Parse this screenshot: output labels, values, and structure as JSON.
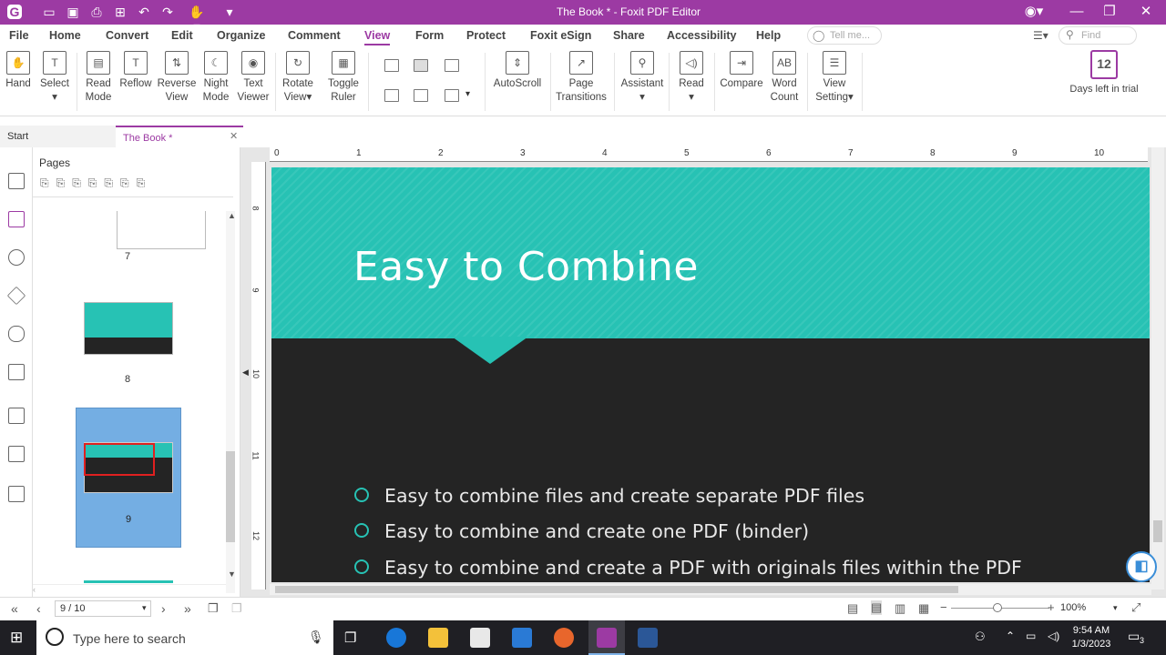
{
  "app": {
    "title": "The Book * - Foxit PDF Editor",
    "accent": "#9c3aa3"
  },
  "menu": [
    "File",
    "Home",
    "Convert",
    "Edit",
    "Organize",
    "Comment",
    "View",
    "Form",
    "Protect",
    "Foxit eSign",
    "Share",
    "Accessibility",
    "Help"
  ],
  "menu_active": "View",
  "search": {
    "tellme": "Tell me...",
    "find": "Find"
  },
  "ribbon": {
    "hand": "Hand",
    "select": "Select",
    "read_mode": [
      "Read",
      "Mode"
    ],
    "reflow": "Reflow",
    "reverse_view": [
      "Reverse",
      "View"
    ],
    "night_mode": [
      "Night",
      "Mode"
    ],
    "text_viewer": [
      "Text",
      "Viewer"
    ],
    "rotate_view": [
      "Rotate",
      "View▾"
    ],
    "toggle_ruler": [
      "Toggle",
      "Ruler"
    ],
    "autoscroll": "AutoScroll",
    "page_transitions": [
      "Page",
      "Transitions"
    ],
    "assistant": "Assistant",
    "read": "Read",
    "compare": "Compare",
    "word_count": [
      "Word",
      "Count"
    ],
    "view_setting": [
      "View",
      "Setting▾"
    ],
    "trial_days": "12",
    "trial_label": "Days left in trial"
  },
  "tabs": {
    "start": "Start",
    "doc": "The Book *"
  },
  "panel": {
    "title": "Pages",
    "pages": [
      "7",
      "8",
      "9"
    ]
  },
  "ruler": {
    "h": [
      "0",
      "1",
      "2",
      "3",
      "4",
      "5",
      "6",
      "7",
      "8",
      "9",
      "10"
    ],
    "v": [
      "8",
      "9",
      "10",
      "11",
      "12"
    ]
  },
  "slide": {
    "title": "Easy to Combine",
    "bullets": [
      "Easy to combine files and create separate PDF files",
      "Easy to combine and create one PDF (binder)",
      "Easy to combine and create a PDF with originals files within the PDF"
    ],
    "accent": "#27c2b4",
    "background": "#242424"
  },
  "status": {
    "page": "9 / 10",
    "zoom": "100%"
  },
  "taskbar": {
    "search": "Type here to search",
    "time": "9:54 AM",
    "date": "1/3/2023",
    "notif": "3"
  }
}
